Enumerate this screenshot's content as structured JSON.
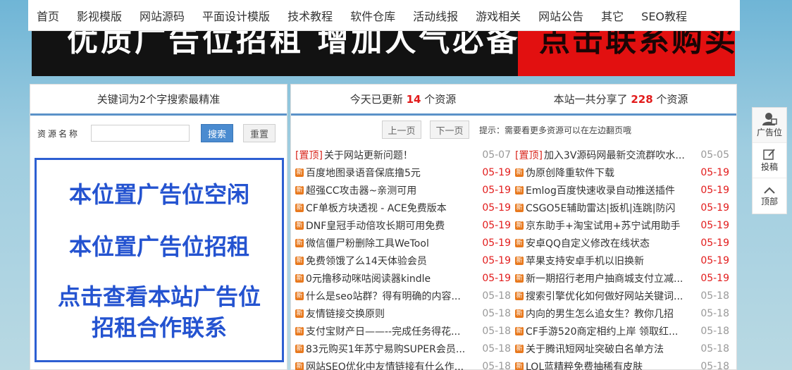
{
  "nav": [
    "首页",
    "影视模版",
    "网站源码",
    "平面设计模版",
    "技术教程",
    "软件仓库",
    "活动线报",
    "游戏相关",
    "网站公告",
    "其它",
    "SEO教程"
  ],
  "banner": {
    "left_text": "优质广告位招租 增加人气必备",
    "right_text": "点击联系购买"
  },
  "search": {
    "header": "关键词为2个字搜索最精准",
    "label": "资源名称",
    "placeholder": "",
    "search_btn": "搜索",
    "reset_btn": "重置"
  },
  "ad": {
    "line1": "本位置广告位空闲",
    "line2": "本位置广告位招租",
    "line3a": "点击查看本站广告位",
    "line3b": "招租合作联系"
  },
  "stats": {
    "today_prefix": "今天已更新 ",
    "today_count": "14",
    "today_suffix": " 个资源",
    "total_prefix": "本站一共分享了 ",
    "total_count": "228",
    "total_suffix": " 个资源"
  },
  "pager": {
    "prev": "上一页",
    "next": "下一页",
    "tip": "提示：需要看更多资源可以在左边翻页哦"
  },
  "rows": [
    [
      {
        "tag": "[置顶]",
        "title": "关于网站更新问题！",
        "date": "05-07",
        "color": "gray"
      },
      {
        "tag": "[置顶]",
        "title": "加入3V源码网最新交流群吹水...",
        "date": "05-05",
        "color": "gray"
      }
    ],
    [
      {
        "tag": "",
        "title": "百度地图录语音保底撸5元",
        "date": "05-19",
        "color": "red"
      },
      {
        "tag": "",
        "title": "伪原创降重软件下载",
        "date": "05-19",
        "color": "red"
      }
    ],
    [
      {
        "tag": "",
        "title": "超强CC攻击器~亲测可用",
        "date": "05-19",
        "color": "red"
      },
      {
        "tag": "",
        "title": "Emlog百度快速收录自动推送插件",
        "date": "05-19",
        "color": "red"
      }
    ],
    [
      {
        "tag": "",
        "title": "CF单板方块透视 - ACE免费版本",
        "date": "05-19",
        "color": "red"
      },
      {
        "tag": "",
        "title": "CSGO5E辅助雷达|扳机|连跳|防闪",
        "date": "05-19",
        "color": "red"
      }
    ],
    [
      {
        "tag": "",
        "title": "DNF皇冠手动倍攻长期可用免费",
        "date": "05-19",
        "color": "red"
      },
      {
        "tag": "",
        "title": "京东助手+淘宝试用+苏宁试用助手",
        "date": "05-19",
        "color": "red"
      }
    ],
    [
      {
        "tag": "",
        "title": "微信僵尸粉删除工具WeTool",
        "date": "05-19",
        "color": "red"
      },
      {
        "tag": "",
        "title": "安卓QQ自定义修改在线状态",
        "date": "05-19",
        "color": "red"
      }
    ],
    [
      {
        "tag": "",
        "title": "免费领饿了么14天体验会员",
        "date": "05-19",
        "color": "red"
      },
      {
        "tag": "",
        "title": "苹果支持安卓手机以旧换新",
        "date": "05-19",
        "color": "red"
      }
    ],
    [
      {
        "tag": "",
        "title": "0元撸移动咪咕阅读器kindle",
        "date": "05-19",
        "color": "red"
      },
      {
        "tag": "",
        "title": "新一期招行老用户抽商城支付立减...",
        "date": "05-19",
        "color": "red"
      }
    ],
    [
      {
        "tag": "",
        "title": "什么是seo站群？得有明确的内容...",
        "date": "05-18",
        "color": "gray"
      },
      {
        "tag": "",
        "title": "搜索引擎优化如何做好网站关键词...",
        "date": "05-18",
        "color": "gray"
      }
    ],
    [
      {
        "tag": "",
        "title": "友情链接交换原则",
        "date": "05-18",
        "color": "gray"
      },
      {
        "tag": "",
        "title": "内向的男生怎么追女生？教你几招",
        "date": "05-18",
        "color": "gray"
      }
    ],
    [
      {
        "tag": "",
        "title": "支付宝财产日——--完成任务得花...",
        "date": "05-18",
        "color": "gray"
      },
      {
        "tag": "",
        "title": "CF手游520商定相约上岸 领取红...",
        "date": "05-18",
        "color": "gray"
      }
    ],
    [
      {
        "tag": "",
        "title": "83元购买1年苏宁易购SUPER会员...",
        "date": "05-18",
        "color": "gray"
      },
      {
        "tag": "",
        "title": "关于腾讯短网址突破白名单方法",
        "date": "05-18",
        "color": "gray"
      }
    ],
    [
      {
        "tag": "",
        "title": "网站SEO优化中友情链接有什么作...",
        "date": "05-18",
        "color": "gray"
      },
      {
        "tag": "",
        "title": "LOL蓝精粹免费抽稀有皮肤",
        "date": "05-18",
        "color": "gray"
      }
    ]
  ],
  "new_icon_text": "新",
  "side": [
    {
      "label": "广告位",
      "icon": "user-icon"
    },
    {
      "label": "投稿",
      "icon": "edit-icon"
    },
    {
      "label": "顶部",
      "icon": "chevron-up-icon"
    }
  ],
  "colors": {
    "accent": "#5b92c8",
    "red": "#e21b1b",
    "ad_blue": "#2453d0",
    "button_blue": "#4a8bd0"
  }
}
